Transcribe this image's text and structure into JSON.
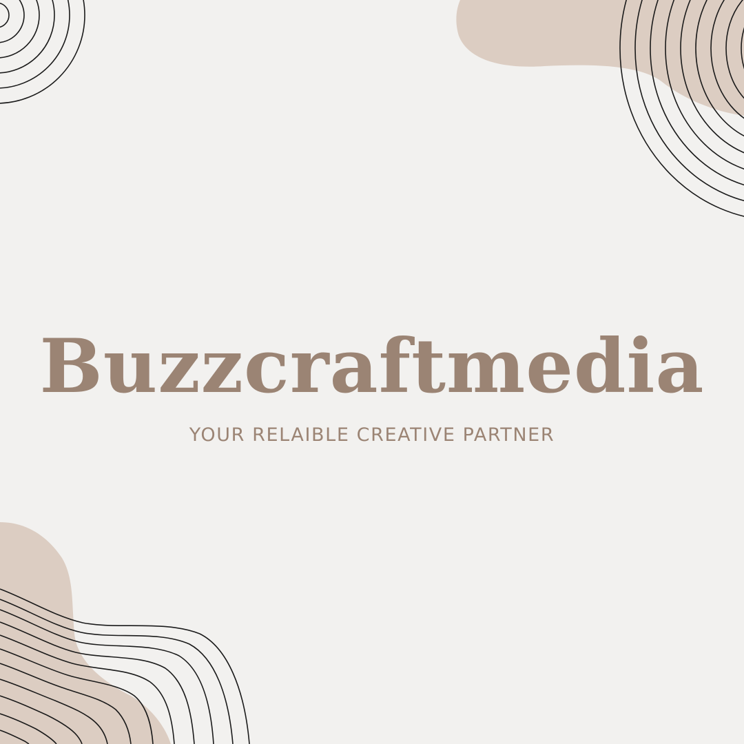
{
  "brand": {
    "name": "Buzzcraftmedia",
    "tagline": "YOUR RELAIBLE CREATIVE PARTNER"
  },
  "colors": {
    "background": "#f2f1ef",
    "accent": "#9b8474",
    "blob": "#dccdc2",
    "line": "#1a1a1a"
  },
  "decorations": {
    "top_left": "concentric-arcs",
    "top_right": "blob-with-concentric-arcs",
    "bottom_left": "blob-with-wavy-lines"
  }
}
